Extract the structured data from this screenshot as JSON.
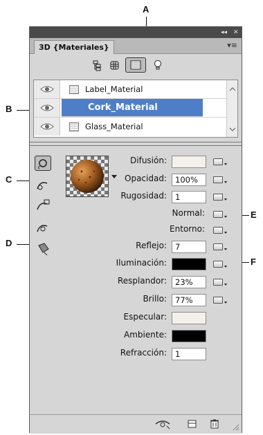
{
  "callouts": {
    "a": "A",
    "b": "B",
    "c": "C",
    "d": "D",
    "e": "E",
    "f": "F"
  },
  "panel": {
    "tab_label": "3D {Materiales}",
    "collapse_glyph": "◂◂",
    "close_glyph": "✕",
    "menu_glyph": "▾≡"
  },
  "filters": [
    {
      "icon": "scene-tree-icon"
    },
    {
      "icon": "mesh-icon"
    },
    {
      "icon": "materials-filter-icon",
      "active": true
    },
    {
      "icon": "light-bulb-icon"
    }
  ],
  "materials": [
    {
      "label": "Label_Material",
      "selected": false
    },
    {
      "label": "Cork_Material",
      "selected": true
    },
    {
      "label": "Glass_Material",
      "selected": false
    }
  ],
  "tools": [
    {
      "icon": "material-select-tool-icon",
      "active": true
    },
    {
      "icon": "material-drop-tool-icon"
    },
    {
      "icon": "material-tool-3-icon"
    },
    {
      "icon": "material-tool-4-icon"
    },
    {
      "icon": "material-paint-bucket-icon"
    }
  ],
  "properties": [
    {
      "label": "Difusión:",
      "value": "",
      "swatch": "#f4f1ea",
      "texture": true
    },
    {
      "label": "Opacidad:",
      "value": "100%",
      "texture": true
    },
    {
      "label": "Rugosidad:",
      "value": "1",
      "texture": true
    },
    {
      "label": "Normal:",
      "texture": true
    },
    {
      "label": "Entorno:",
      "texture": true
    },
    {
      "label": "Reflejo:",
      "value": "7",
      "texture": true
    },
    {
      "label": "Iluminación:",
      "swatch": "#000000",
      "texture": true
    },
    {
      "label": "Resplandor:",
      "value": "23%",
      "texture": true
    },
    {
      "label": "Brillo:",
      "value": "77%",
      "texture": true
    },
    {
      "label": "Especular:",
      "swatch": "#f4f1ea"
    },
    {
      "label": "Ambiente:",
      "swatch": "#000000"
    },
    {
      "label": "Refracción:",
      "value": "1"
    }
  ]
}
